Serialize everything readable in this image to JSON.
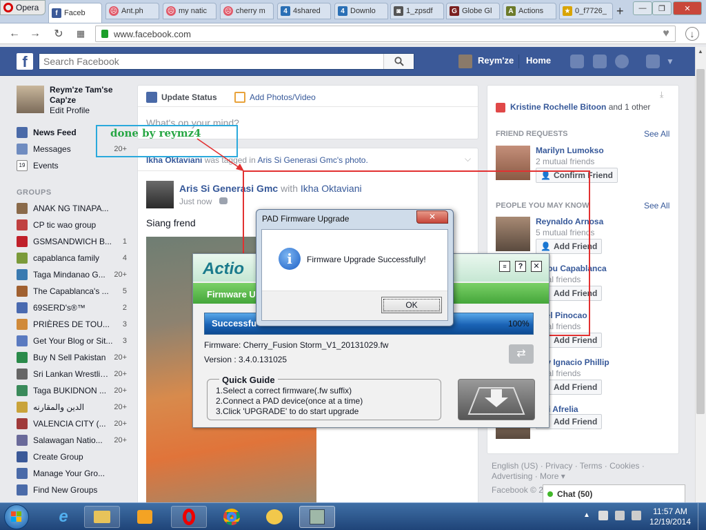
{
  "browser": {
    "app_label": "Opera",
    "tabs": [
      {
        "label": "Faceb",
        "active": true
      },
      {
        "label": "Ant.ph"
      },
      {
        "label": "my natic"
      },
      {
        "label": "cherry m"
      },
      {
        "label": "4shared"
      },
      {
        "label": "Downlo"
      },
      {
        "label": "1_zpsdf"
      },
      {
        "label": "Globe Gl"
      },
      {
        "label": "Actions"
      },
      {
        "label": "0_f7726_"
      }
    ],
    "url": "www.facebook.com"
  },
  "fb": {
    "search_placeholder": "Search Facebook",
    "user_short": "Reym'ze",
    "home": "Home",
    "profile_name": "Reym'ze Tam'se Cap'ze",
    "edit_profile": "Edit Profile",
    "nav": [
      {
        "label": "News Feed",
        "count": ""
      },
      {
        "label": "Messages",
        "count": "20+"
      },
      {
        "label": "Events",
        "count": ""
      }
    ],
    "groups_title": "GROUPS",
    "groups": [
      {
        "label": "ANAK NG TINAPA...",
        "count": ""
      },
      {
        "label": "CP tic wao group",
        "count": ""
      },
      {
        "label": "GSMSANDWICH B...",
        "count": "1"
      },
      {
        "label": "capablanca family",
        "count": "4"
      },
      {
        "label": "Taga Mindanao G...",
        "count": "20+"
      },
      {
        "label": "The Capablanca's ...",
        "count": "5"
      },
      {
        "label": "69SERD's®™",
        "count": "2"
      },
      {
        "label": "PRIÈRES DE TOU...",
        "count": "3"
      },
      {
        "label": "Get Your Blog or Sit...",
        "count": "3"
      },
      {
        "label": "Buy N Sell Pakistan",
        "count": "20+"
      },
      {
        "label": "Sri Lankan Wrestli ...",
        "count": "20+"
      },
      {
        "label": "Taga BUKIDNON ...",
        "count": "20+"
      },
      {
        "label": "الدين والمقارنه",
        "count": "20+"
      },
      {
        "label": "VALENCIA CITY (...",
        "count": "20+"
      },
      {
        "label": "Salawagan Natio...",
        "count": "20+"
      },
      {
        "label": "Create Group",
        "count": ""
      },
      {
        "label": "Manage Your Gro...",
        "count": ""
      },
      {
        "label": "Find New Groups",
        "count": ""
      }
    ],
    "composer": {
      "update_status": "Update Status",
      "add_photos": "Add Photos/Video",
      "placeholder": "What's on your mind?"
    },
    "post": {
      "tag_line_name": "Ikha Oktaviani",
      "tag_line_mid": "was tagged in",
      "tag_line_target": "Aris Si Generasi Gmc's photo.",
      "author": "Aris Si Generasi Gmc",
      "with": "with",
      "with_name": "Ikha Oktaviani",
      "time": "Just now",
      "text": "Siang frend"
    },
    "right": {
      "notif_name": "Kristine Rochelle Bitoon",
      "notif_rest": "and 1 other",
      "friend_requests": "FRIEND REQUESTS",
      "see_all": "See All",
      "request_name": "Marilyn Lumokso",
      "request_mutual": "2 mutual friends",
      "confirm": "Confirm Friend",
      "pymk": "PEOPLE YOU MAY KNOW",
      "people": [
        {
          "name": "Reynaldo Arnosa",
          "mutual": "5 mutual friends"
        },
        {
          "name": "a Lou Capablanca",
          "mutual": "utual friends"
        },
        {
          "name": "nuel Pinocao",
          "mutual": "utual friends"
        },
        {
          "name": "Poy Ignacio Phillip",
          "mutual": "utual friends"
        },
        {
          "name": "anti Afrelia",
          "mutual": ""
        }
      ],
      "add_friend": "Add Friend",
      "footer_links": "English (US) · Privacy · Terms · Cookies ·",
      "footer_links2": "Advertising · More ▾",
      "copyright": "Facebook © 2",
      "chat": "Chat (50)"
    }
  },
  "annotation": {
    "text": "done by reymz4"
  },
  "actions_dialog": {
    "logo_text": "Actio",
    "section": "Firmware U",
    "progress_label": "Successfu",
    "progress_value": "100%",
    "progress": 1.0,
    "firmware": "Firmware: Cherry_Fusion Storm_V1_20131029.fw",
    "version": "Version : 3.4.0.131025",
    "quick_guide_title": "Quick Guide",
    "quick_guide": [
      "1.Select a correct firmware(.fw suffix)",
      "2.Connect a PAD device(once at a time)",
      "3.Click 'UPGRADE' to do start upgrade"
    ]
  },
  "pad_dialog": {
    "title": "PAD Firmware Upgrade",
    "message": "Firmware Upgrade Successfully!",
    "ok": "OK"
  },
  "taskbar": {
    "time": "11:57 AM",
    "date": "12/19/2014"
  },
  "colors": {
    "fb_blue": "#3b5998",
    "link": "#365899",
    "annotation_green": "#28a745",
    "annotation_box": "#29a9dc",
    "red_box": "#e23030"
  }
}
